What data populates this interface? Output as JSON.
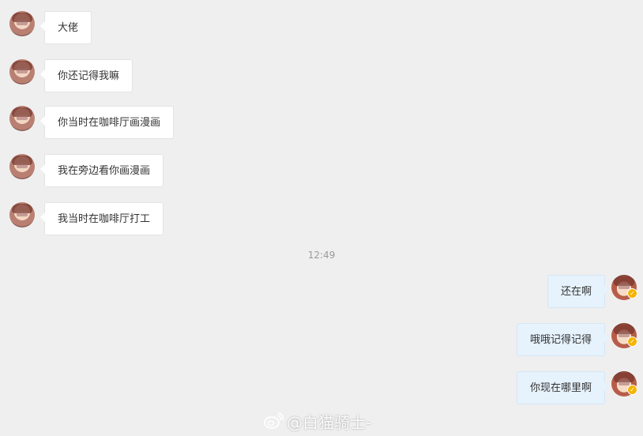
{
  "conversation": {
    "incoming": [
      {
        "text": "大佬"
      },
      {
        "text": "你还记得我嘛"
      },
      {
        "text": "你当时在咖啡厅画漫画"
      },
      {
        "text": "我在旁边看你画漫画"
      },
      {
        "text": "我当时在咖啡厅打工"
      }
    ],
    "timestamp": "12:49",
    "outgoing": [
      {
        "text": "还在啊"
      },
      {
        "text": "哦哦记得记得"
      },
      {
        "text": "你现在哪里啊"
      }
    ]
  },
  "watermark": {
    "text": "@白猫骑士-",
    "icon": "weibo-logo-icon"
  },
  "colors": {
    "background": "#efefef",
    "incoming_bubble": "#ffffff",
    "outgoing_bubble": "#e6f2fc",
    "timestamp": "#9a9a9a",
    "verified_badge": "#f5b400"
  }
}
